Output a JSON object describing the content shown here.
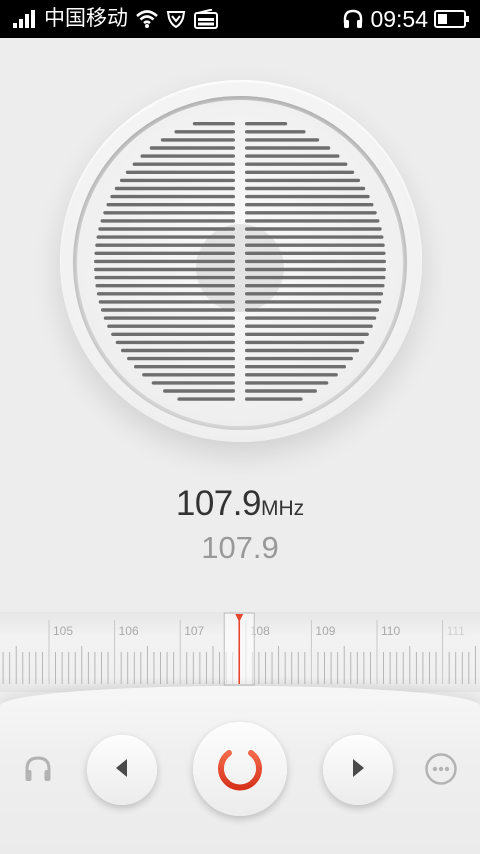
{
  "status_bar": {
    "carrier": "中国移动",
    "time": "09:54",
    "icons": [
      "signal-icon",
      "wifi-icon",
      "shield-icon",
      "radio-icon",
      "headset-icon",
      "battery-icon"
    ]
  },
  "station": {
    "frequency": "107.9",
    "unit": "MHz",
    "name": "107.9"
  },
  "tuner": {
    "marks": [
      "105",
      "106",
      "107",
      "108",
      "109",
      "110",
      "111"
    ],
    "selected_frequency": 107.9,
    "accent_color": "#e8472e"
  },
  "controls": {
    "icons": [
      "headset-icon",
      "previous-icon",
      "power-icon",
      "next-icon",
      "more-icon"
    ]
  }
}
